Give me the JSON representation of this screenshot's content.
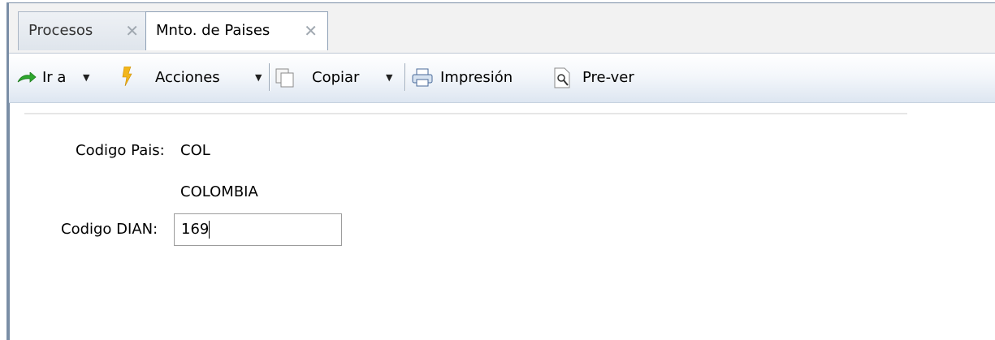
{
  "tabs": [
    {
      "label": "Procesos",
      "active": false
    },
    {
      "label": "Mnto. de Paises",
      "active": true
    }
  ],
  "toolbar": {
    "ir_a": "Ir a",
    "acciones": "Acciones",
    "copiar": "Copiar",
    "impresion": "Impresión",
    "prever": "Pre-ver"
  },
  "form": {
    "codigo_pais_label": "Codigo Pais:",
    "codigo_pais_value": "COL",
    "pais_nombre": "COLOMBIA",
    "codigo_dian_label": "Codigo DIAN:",
    "codigo_dian_value": "169"
  },
  "colors": {
    "frame_border": "#7a8ea6",
    "toolbar_bottom": "#dde6f1",
    "go_arrow": "#2ea82e",
    "acciones_icon": "#f2b61c"
  },
  "icons": [
    "go-arrow-icon",
    "lightning-icon",
    "copy-icon",
    "printer-icon",
    "preview-icon",
    "close-icon"
  ]
}
